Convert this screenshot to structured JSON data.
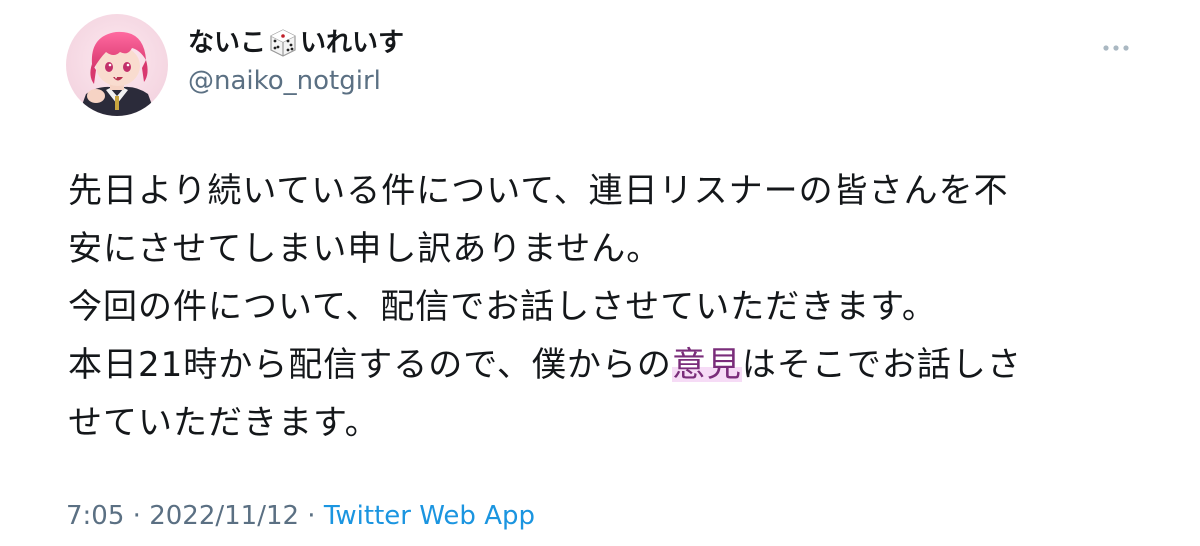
{
  "user": {
    "display_name_prefix": "ないこ",
    "display_name_suffix": "いれいす",
    "emoji_icon": "dice-icon",
    "handle": "@naiko_notgirl"
  },
  "more_menu": {
    "icon": "more-horizontal-icon"
  },
  "tweet": {
    "lines": [
      "先日より続いている件について、連日リスナーの皆さんを不",
      "安にさせてしまい申し訳ありません。",
      "今回の件について、配信でお話しさせていただきます。",
      "本日21時から配信するので、僕からの",
      "意見",
      "はそこでお話しさ",
      "せていただきます。"
    ]
  },
  "meta": {
    "time": "7:05",
    "separator": " · ",
    "date": "2022/11/12",
    "source": "Twitter Web App"
  },
  "colors": {
    "text": "#14171a",
    "secondary": "#5b7083",
    "link": "#1b95e0",
    "highlight": "#eebeee"
  }
}
